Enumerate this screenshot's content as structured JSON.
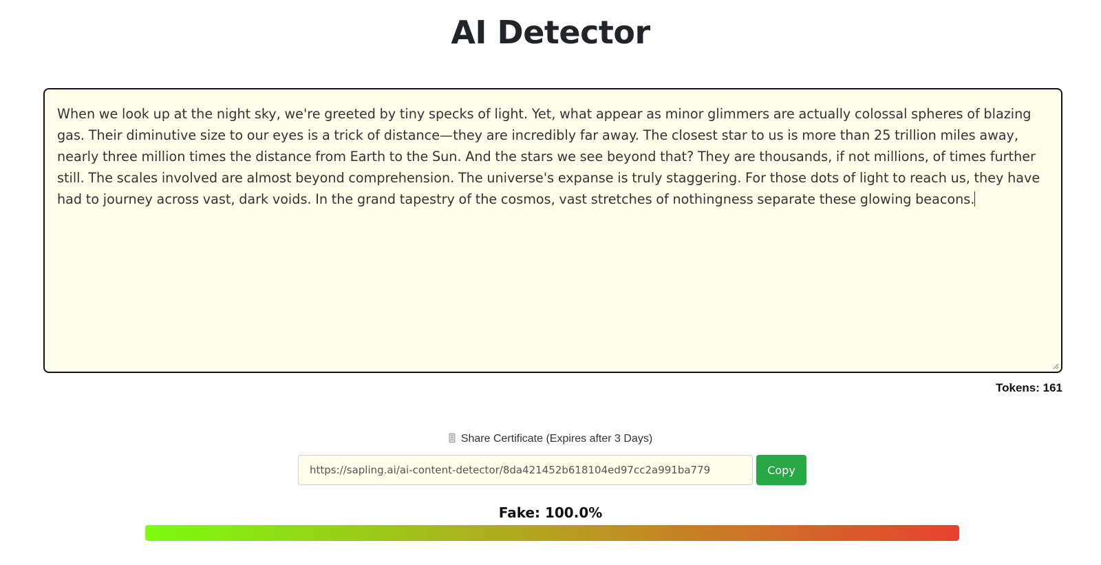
{
  "page": {
    "title": "AI Detector"
  },
  "editor": {
    "text": "When we look up at the night sky, we're greeted by tiny specks of light. Yet, what appear as minor glimmers are actually colossal spheres of blazing gas. Their diminutive size to our eyes is a trick of distance—they are incredibly far away. The closest star to us is more than 25 trillion miles away, nearly three million times the distance from Earth to the Sun. And the stars we see beyond that? They are thousands, if not millions, of times further still. The scales involved are almost beyond comprehension. The universe's expanse is truly staggering. For those dots of light to reach us, they have had to journey across vast, dark voids. In the grand tapestry of the cosmos, vast stretches of nothingness separate these glowing beacons.",
    "tokens_label": "Tokens: 161"
  },
  "share": {
    "icon": "scroll-icon",
    "label": "Share Certificate (Expires after 3 Days)",
    "url": "https://sapling.ai/ai-content-detector/8da421452b618104ed97cc2a991ba779",
    "copy_label": "Copy"
  },
  "result": {
    "label": "Fake: 100.0%",
    "fake_fraction": 1.0
  },
  "colors": {
    "copy_button": "#28a745",
    "editor_background": "#fefeeb",
    "gradient_start": "#7cfc10",
    "gradient_end": "#e8412f"
  }
}
